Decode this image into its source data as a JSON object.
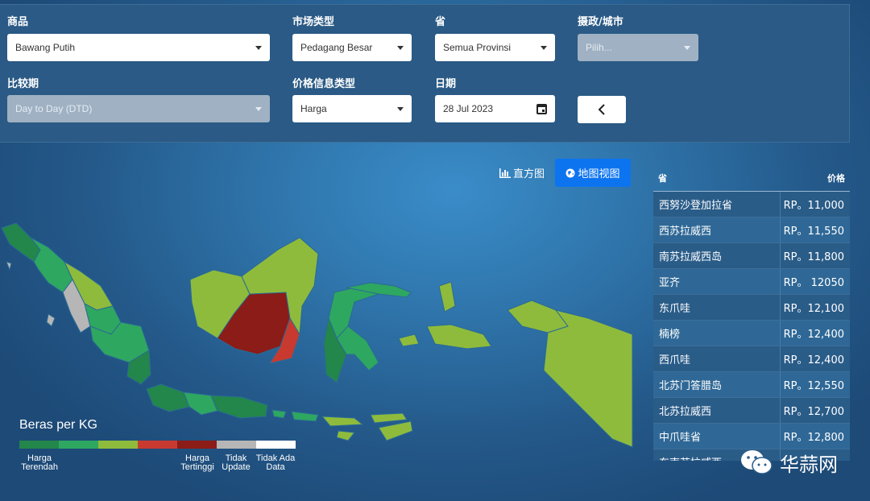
{
  "filters": {
    "commodity": {
      "label": "商品",
      "value": "Bawang Putih"
    },
    "market_type": {
      "label": "市场类型",
      "value": "Pedagang Besar"
    },
    "province": {
      "label": "省",
      "value": "Semua Provinsi"
    },
    "city": {
      "label": "摄政/城市",
      "placeholder": "Pilih..."
    },
    "compare": {
      "label": "比较期",
      "value": "Day to Day (DTD)"
    },
    "price_type": {
      "label": "价格信息类型",
      "value": "Harga"
    },
    "date": {
      "label": "日期",
      "value": "28 Jul 2023"
    },
    "back_icon": "chevron-left-icon"
  },
  "view": {
    "histogram_label": "直方图",
    "map_label": "地图视图",
    "active": "map"
  },
  "table": {
    "col_province": "省",
    "col_price": "价格",
    "rows": [
      {
        "province": "西努沙登加拉省",
        "price": "RP。11,000"
      },
      {
        "province": "西苏拉威西",
        "price": "RP。11,550"
      },
      {
        "province": "南苏拉威西岛",
        "price": "RP。11,800"
      },
      {
        "province": "亚齐",
        "price": "RP。 12050"
      },
      {
        "province": "东爪哇",
        "price": "RP。12,100"
      },
      {
        "province": "楠榜",
        "price": "RP。12,400"
      },
      {
        "province": "西爪哇",
        "price": "RP。12,400"
      },
      {
        "province": "北苏门答腊岛",
        "price": "RP。12,550"
      },
      {
        "province": "北苏拉威西",
        "price": "RP。12,700"
      },
      {
        "province": "中爪哇省",
        "price": "RP。12,800"
      },
      {
        "province": "东南苏拉威西",
        "price": ""
      }
    ]
  },
  "legend": {
    "title": "Beras per KG",
    "colors": [
      "#23864a",
      "#2ea760",
      "#8fbb3c",
      "#c83a30",
      "#8b1c17",
      "#b6b6b6",
      "#ffffff"
    ],
    "low_label": "Harga Terendah",
    "high_label": "Harga Tertinggi",
    "no_update_label": "Tidak Update",
    "no_data_label": "Tidak Ada Data"
  },
  "watermark": {
    "text": "华蒜网",
    "icon": "wechat-icon"
  }
}
